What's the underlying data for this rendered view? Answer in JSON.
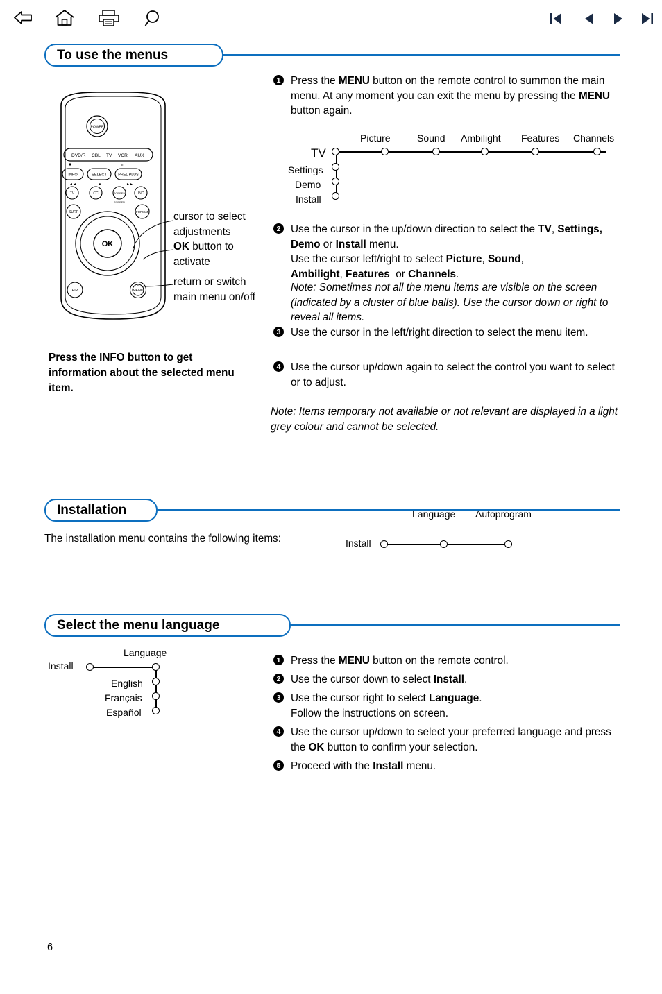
{
  "toolbar": {
    "icons": [
      {
        "name": "back-arrow-icon",
        "glyph": "back"
      },
      {
        "name": "home-icon",
        "glyph": "home"
      },
      {
        "name": "print-icon",
        "glyph": "print"
      },
      {
        "name": "search-icon",
        "glyph": "search"
      },
      {
        "name": "first-page-icon",
        "glyph": "first"
      },
      {
        "name": "previous-page-icon",
        "glyph": "prev"
      },
      {
        "name": "next-page-icon",
        "glyph": "next"
      },
      {
        "name": "last-page-icon",
        "glyph": "last"
      }
    ]
  },
  "accent_color": "#0d6fbf",
  "sections": {
    "menus": {
      "title": "To use the menus",
      "steps": [
        {
          "num": "1",
          "parts": [
            {
              "t": "Press the ",
              "s": "n"
            },
            {
              "t": "MENU",
              "s": "b"
            },
            {
              "t": " button on the remote control to summon the main menu. At any moment you can exit the menu by pressing the ",
              "s": "n"
            },
            {
              "t": "MENU",
              "s": "b"
            },
            {
              "t": " button again.",
              "s": "n"
            }
          ]
        },
        {
          "num": "2",
          "parts": [
            {
              "t": "Use the cursor in the up/down direction to select the ",
              "s": "n"
            },
            {
              "t": "TV",
              "s": "b"
            },
            {
              "t": ", ",
              "s": "n"
            },
            {
              "t": "Settings, Demo",
              "s": "b"
            },
            {
              "t": " or ",
              "s": "n"
            },
            {
              "t": "Install",
              "s": "b"
            },
            {
              "t": " menu.",
              "s": "n"
            }
          ]
        },
        {
          "num": "3",
          "parts": [
            {
              "t": "Use the cursor in the left/right direction to select the menu item.",
              "s": "n"
            }
          ]
        },
        {
          "num": "4",
          "parts": [
            {
              "t": "Use the cursor up/down again to select the control you want to select or to adjust.",
              "s": "n"
            }
          ]
        }
      ],
      "step2_extra_line1": [
        {
          "t": "Use the cursor left/right to select ",
          "s": "n"
        },
        {
          "t": "Picture",
          "s": "b"
        },
        {
          "t": ", ",
          "s": "n"
        },
        {
          "t": "Sound",
          "s": "b"
        },
        {
          "t": ",",
          "s": "n"
        }
      ],
      "step2_extra_line2": [
        {
          "t": "Ambilight",
          "s": "b"
        },
        {
          "t": ", ",
          "s": "n"
        },
        {
          "t": "Features",
          "s": "b"
        },
        {
          "t": "  or ",
          "s": "n"
        },
        {
          "t": "Channels",
          "s": "b"
        },
        {
          "t": ".",
          "s": "n"
        }
      ],
      "note_cluster": "Note: Sometimes not all the menu items are visible on the screen (indicated by a cluster of blue balls). Use the cursor down or right to reveal all items.",
      "note_grey": "Note: Items temporary not available or not relevant are displayed in a light grey colour and cannot be selected.",
      "tree": {
        "row_labels": [
          "TV",
          "Settings",
          "Demo",
          "Install"
        ],
        "col_labels": [
          "Picture",
          "Sound",
          "Ambilight",
          "Features",
          "Channels"
        ]
      },
      "callouts": [
        {
          "line1": "cursor to select",
          "line2": "adjustments"
        },
        {
          "line1_bold": "OK",
          "line1_rest": " button to",
          "line2": "activate"
        },
        {
          "line1": "return or switch",
          "line2": "main menu on/off"
        }
      ],
      "info_note": "Press the INFO button to get information about the selected menu item."
    },
    "installation": {
      "title": "Installation",
      "intro": "The installation menu contains the following items:",
      "tree": {
        "row_label": "Install",
        "col_labels": [
          "Language",
          "Autoprogram"
        ]
      }
    },
    "language": {
      "title": "Select the menu language",
      "tree": {
        "row_label": "Install",
        "top_label": "Language",
        "items": [
          "English",
          "Français",
          "Español"
        ]
      },
      "steps": [
        {
          "num": "1",
          "parts": [
            {
              "t": "Press the ",
              "s": "n"
            },
            {
              "t": "MENU",
              "s": "b"
            },
            {
              "t": " button on the remote control.",
              "s": "n"
            }
          ]
        },
        {
          "num": "2",
          "parts": [
            {
              "t": "Use the cursor down to select ",
              "s": "n"
            },
            {
              "t": "Install",
              "s": "b"
            },
            {
              "t": ".",
              "s": "n"
            }
          ]
        },
        {
          "num": "3",
          "parts": [
            {
              "t": "Use the cursor right to select ",
              "s": "n"
            },
            {
              "t": "Language",
              "s": "b"
            },
            {
              "t": ".",
              "s": "n"
            },
            {
              "t": "\nFollow the instructions on screen.",
              "s": "n"
            }
          ]
        },
        {
          "num": "4",
          "parts": [
            {
              "t": "Use the cursor up/down to select your preferred language and press the ",
              "s": "n"
            },
            {
              "t": "OK",
              "s": "b"
            },
            {
              "t": " button to confirm your selection.",
              "s": "n"
            }
          ]
        },
        {
          "num": "5",
          "parts": [
            {
              "t": "Proceed with the ",
              "s": "n"
            },
            {
              "t": "Install",
              "s": "b"
            },
            {
              "t": " menu.",
              "s": "n"
            }
          ]
        }
      ]
    }
  },
  "remote": {
    "power_label": "POWER",
    "source_row": [
      "DVD/R",
      "CBL",
      "TV",
      "VCR",
      "AUX"
    ],
    "row2": [
      "INFO",
      "SELECT",
      "PREL PLUS"
    ],
    "row3": [
      "◄◄",
      "■",
      "►►"
    ],
    "row4": [
      "TV",
      "CC",
      "SCREEN FORMAT",
      "INC"
    ],
    "row5": [
      "SURF",
      "FORMAT"
    ],
    "ok_label": "OK",
    "bottom_row": [
      "PIP",
      "MENU"
    ]
  },
  "page_number": "6"
}
